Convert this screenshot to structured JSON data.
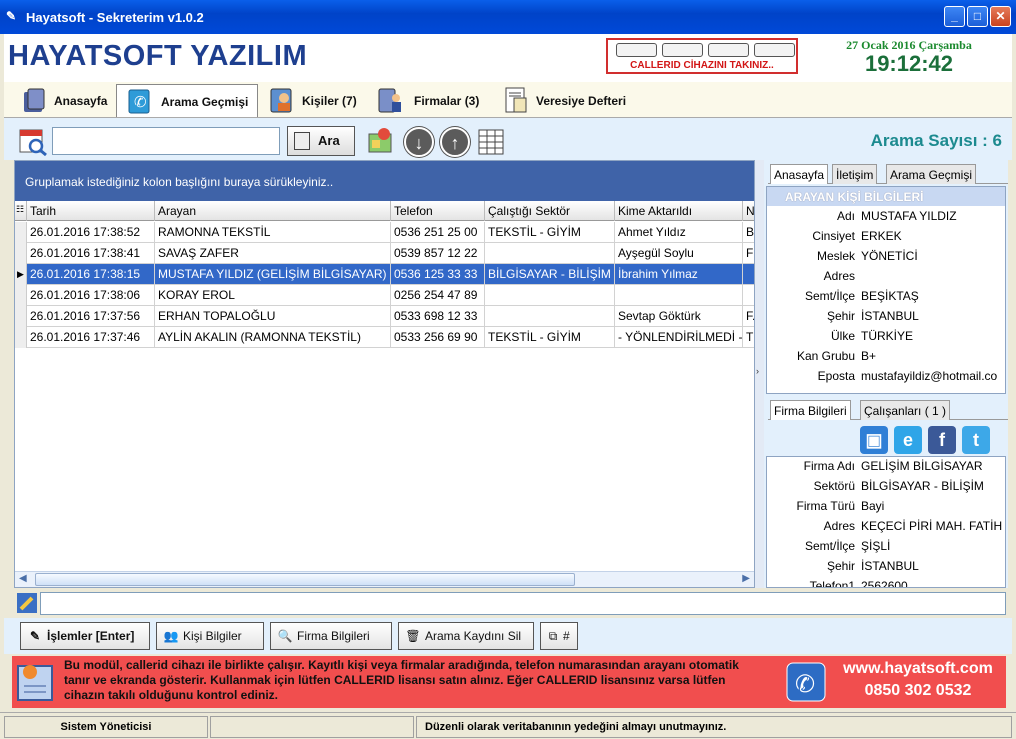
{
  "window": {
    "title": "Hayatsoft - Sekreterim v1.0.2"
  },
  "header": {
    "brand": "HAYATSOFT YAZILIM",
    "callerid_msg": "CALLERID CİHAZINI TAKINIZ..",
    "date": "27 Ocak 2016 Çarşamba",
    "time": "19:12:42"
  },
  "tabs": [
    "Anasayfa",
    "Arama Geçmişi",
    "Kişiler (7)",
    "Firmalar (3)",
    "Veresiye Defteri"
  ],
  "toolbar": {
    "search_value": "",
    "search_button": "Ara",
    "count_label": "Arama Sayısı : 6"
  },
  "grid": {
    "group_hint": "Gruplamak istediğiniz kolon başlığını buraya sürükleyiniz..",
    "columns": [
      "Tarih",
      "Arayan",
      "Telefon",
      "Çalıştığı Sektör",
      "Kime Aktarıldı",
      "N"
    ],
    "rows": [
      [
        "26.01.2016 17:38:52",
        "RAMONNA TEKSTİL",
        "0536 251 25 00",
        "TEKSTİL - GİYİM",
        "Ahmet Yıldız",
        "B("
      ],
      [
        "26.01.2016 17:38:41",
        "SAVAŞ ZAFER",
        "0539 857 12 22",
        "",
        "Ayşegül Soylu",
        "F"
      ],
      [
        "26.01.2016 17:38:15",
        "MUSTAFA YILDIZ (GELİŞİM BİLGİSAYAR)",
        "0536 125 33 33",
        "BİLGİSAYAR - BİLİŞİM",
        "İbrahim Yılmaz",
        ""
      ],
      [
        "26.01.2016 17:38:06",
        "KORAY EROL",
        "0256 254 47 89",
        "",
        "",
        ""
      ],
      [
        "26.01.2016 17:37:56",
        "ERHAN TOPALOĞLU",
        "0533 698 12 33",
        "",
        "Sevtap Göktürk",
        "F."
      ],
      [
        "26.01.2016 17:37:46",
        "AYLİN AKALIN (RAMONNA TEKSTİL)",
        "0533 256 69 90",
        "TEKSTİL - GİYİM",
        "- YÖNLENDİRİLMEDİ -",
        "T"
      ]
    ]
  },
  "side": {
    "tabs1": [
      "Anasayfa",
      "İletişim",
      "Arama Geçmişi"
    ],
    "person_header": "ARAYAN KİŞİ BİLGİLERİ",
    "person": [
      {
        "k": "Adı",
        "v": "MUSTAFA YILDIZ"
      },
      {
        "k": "Cinsiyet",
        "v": "ERKEK"
      },
      {
        "k": "Meslek",
        "v": "YÖNETİCİ"
      },
      {
        "k": "Adres",
        "v": ""
      },
      {
        "k": "Semt/İlçe",
        "v": "BEŞİKTAŞ"
      },
      {
        "k": "Şehir",
        "v": "İSTANBUL"
      },
      {
        "k": "Ülke",
        "v": "TÜRKİYE"
      },
      {
        "k": "Kan Grubu",
        "v": "B+"
      },
      {
        "k": "Eposta",
        "v": "mustafayildiz@hotmail.co"
      }
    ],
    "tabs2": [
      "Firma Bilgileri",
      "Çalışanları ( 1 )"
    ],
    "firm": [
      {
        "k": "Firma Adı",
        "v": "GELİŞİM BİLGİSAYAR"
      },
      {
        "k": "Sektörü",
        "v": "BİLGİSAYAR - BİLİŞİM"
      },
      {
        "k": "Firma Türü",
        "v": "Bayi"
      },
      {
        "k": "Adres",
        "v": "KEÇECİ PİRİ MAH. FATİH"
      },
      {
        "k": "Semt/İlçe",
        "v": "ŞİŞLİ"
      },
      {
        "k": "Şehir",
        "v": "İSTANBUL"
      },
      {
        "k": "Telefon1",
        "v": "2562600"
      }
    ]
  },
  "actions": [
    "İşlemler [Enter]",
    "Kişi Bilgiler",
    "Firma Bilgileri",
    "Arama Kaydını Sil",
    "#"
  ],
  "info": {
    "text": "Bu modül, callerid cihazı ile birlikte çalışır. Kayıtlı kişi veya firmalar aradığında, telefon numarasından arayanı otomatik tanır ve ekranda gösterir. Kullanmak için lütfen CALLERID lisansı satın alınız. Eğer CALLERID lisansınız varsa lütfen cihazın takılı olduğunu kontrol ediniz.",
    "site": "www.hayatsoft.com",
    "phone": "0850 302 0532"
  },
  "status": {
    "user": "Sistem Yöneticisi",
    "middle": "",
    "message": "Düzenli olarak veritabanının yedeğini almayı unutmayınız."
  }
}
